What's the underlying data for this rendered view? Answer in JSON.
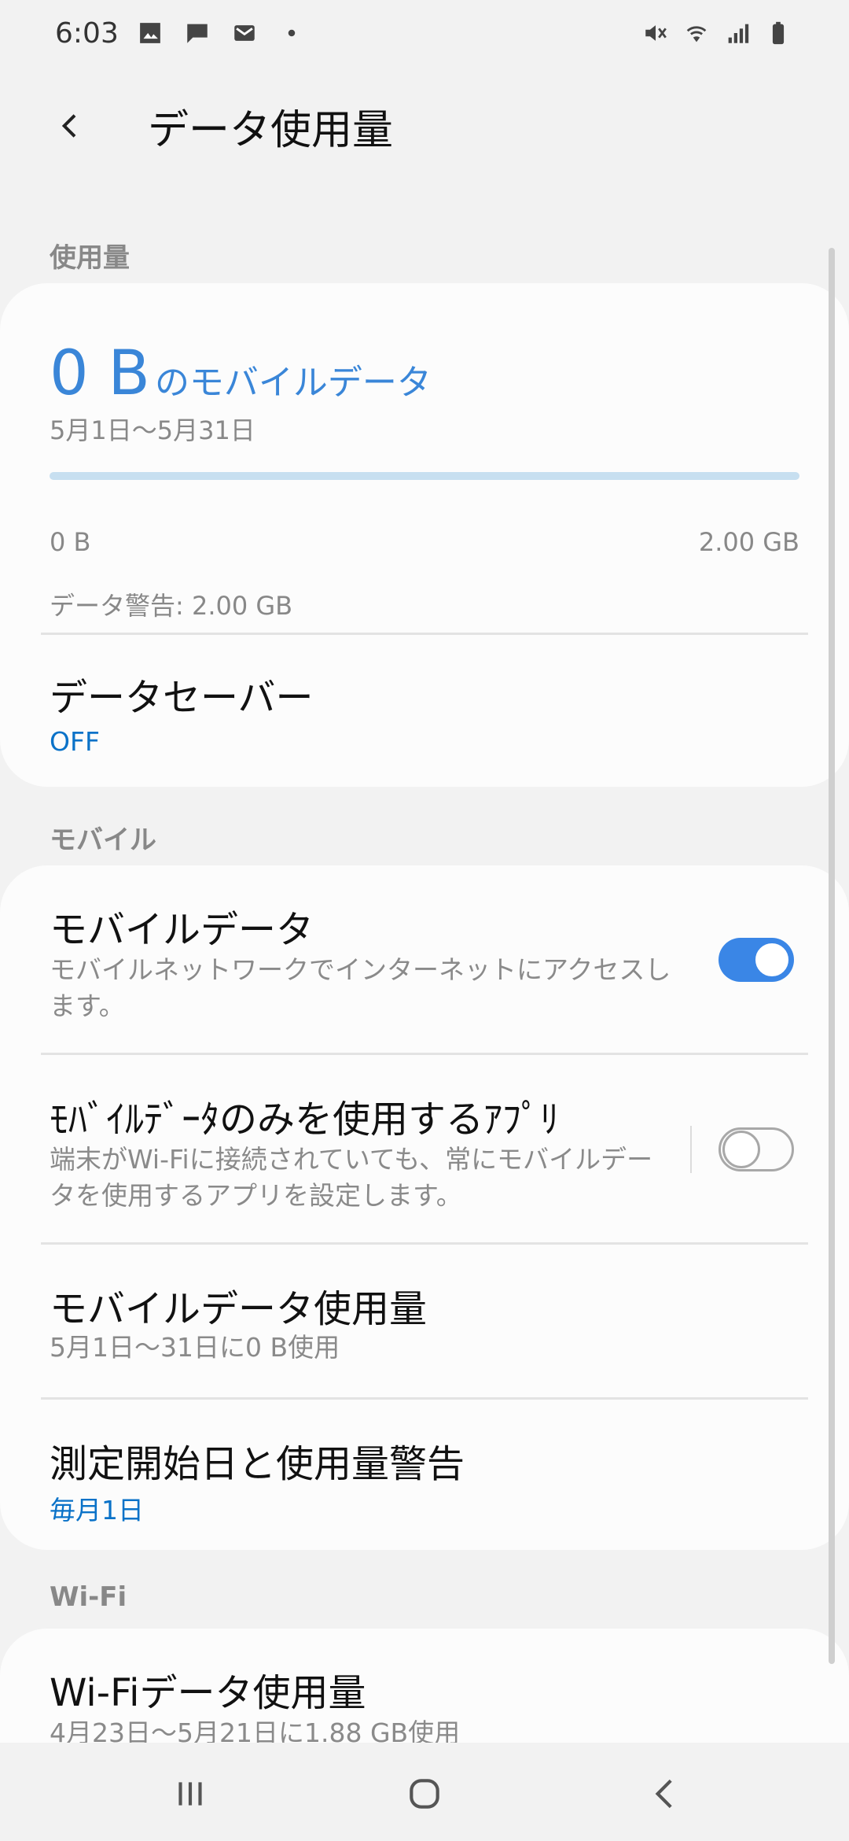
{
  "status_bar": {
    "time": "6:03",
    "left_icons": [
      "gallery-icon",
      "message-icon",
      "gmail-icon",
      "dot-icon"
    ],
    "right_icons": [
      "mute-icon",
      "wifi-icon",
      "signal-icon",
      "battery-icon"
    ]
  },
  "header": {
    "title": "データ使用量"
  },
  "sections": {
    "usage": "使用量",
    "mobile": "モバイル",
    "wifi": "Wi-Fi"
  },
  "usage_card": {
    "amount": "0 B",
    "amount_label": "のモバイルデータ",
    "period": "5月1日〜5月31日",
    "progress_fraction": 0,
    "range_min": "0 B",
    "range_max": "2.00 GB",
    "warning": "データ警告: 2.00 GB",
    "data_saver_title": "データセーバー",
    "data_saver_value": "OFF"
  },
  "mobile_card": {
    "mobile_data_title": "モバイルデータ",
    "mobile_data_desc": "モバイルネットワークでインターネットにアクセスします。",
    "mobile_data_on": true,
    "mobile_only_apps_title": "ﾓﾊﾞｲﾙﾃﾞｰﾀのみを使用するｱﾌﾟﾘ",
    "mobile_only_apps_desc": "端末がWi-Fiに接続されていても、常にモバイルデータを使用するアプリを設定します。",
    "mobile_only_apps_on": false,
    "mobile_usage_title": "モバイルデータ使用量",
    "mobile_usage_desc": "5月1日〜31日に0 B使用",
    "billing_title": "測定開始日と使用量警告",
    "billing_value": "毎月1日"
  },
  "wifi_card": {
    "wifi_usage_title": "Wi-Fiデータ使用量",
    "wifi_usage_desc": "4月23日〜5月21日に1.88 GB使用"
  },
  "colors": {
    "accent": "#3a86d8",
    "link": "#0a72c8",
    "background": "#f2f2f2",
    "card": "#fcfcfc"
  }
}
